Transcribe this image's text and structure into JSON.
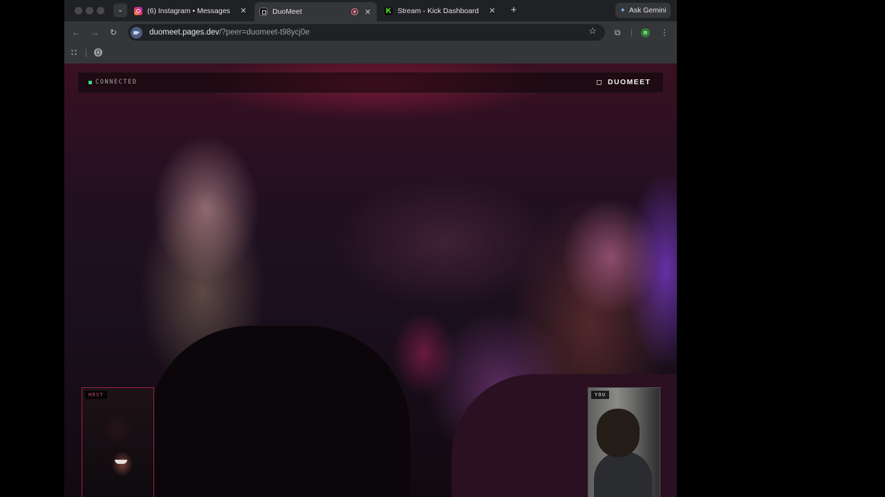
{
  "browser": {
    "tabs": [
      {
        "title": "(6) Instagram • Messages",
        "close": "✕"
      },
      {
        "title": "DuoMeet",
        "close": "✕"
      },
      {
        "title": "Stream - Kick Dashboard",
        "close": "✕"
      }
    ],
    "new_tab": "+",
    "ask_gemini": "Ask Gemini",
    "url_host": "duomeet.pages.dev",
    "url_path": "/?peer=duomeet-t98ycj0e",
    "profile_initial": "R"
  },
  "app": {
    "status": "CONNECTED",
    "status_color": "#3ddc84",
    "brand": "DUOMEET",
    "host_label": "HOST",
    "you_label": "YOU",
    "host_border_color": "#9c2446"
  },
  "icons": {
    "tab_list": "chevron-down-icon",
    "back": "arrow-left-icon",
    "forward": "arrow-right-icon",
    "reload": "reload-icon",
    "bookmark": "star-icon",
    "extensions": "puzzle-icon",
    "menu": "kebab-menu-icon"
  }
}
